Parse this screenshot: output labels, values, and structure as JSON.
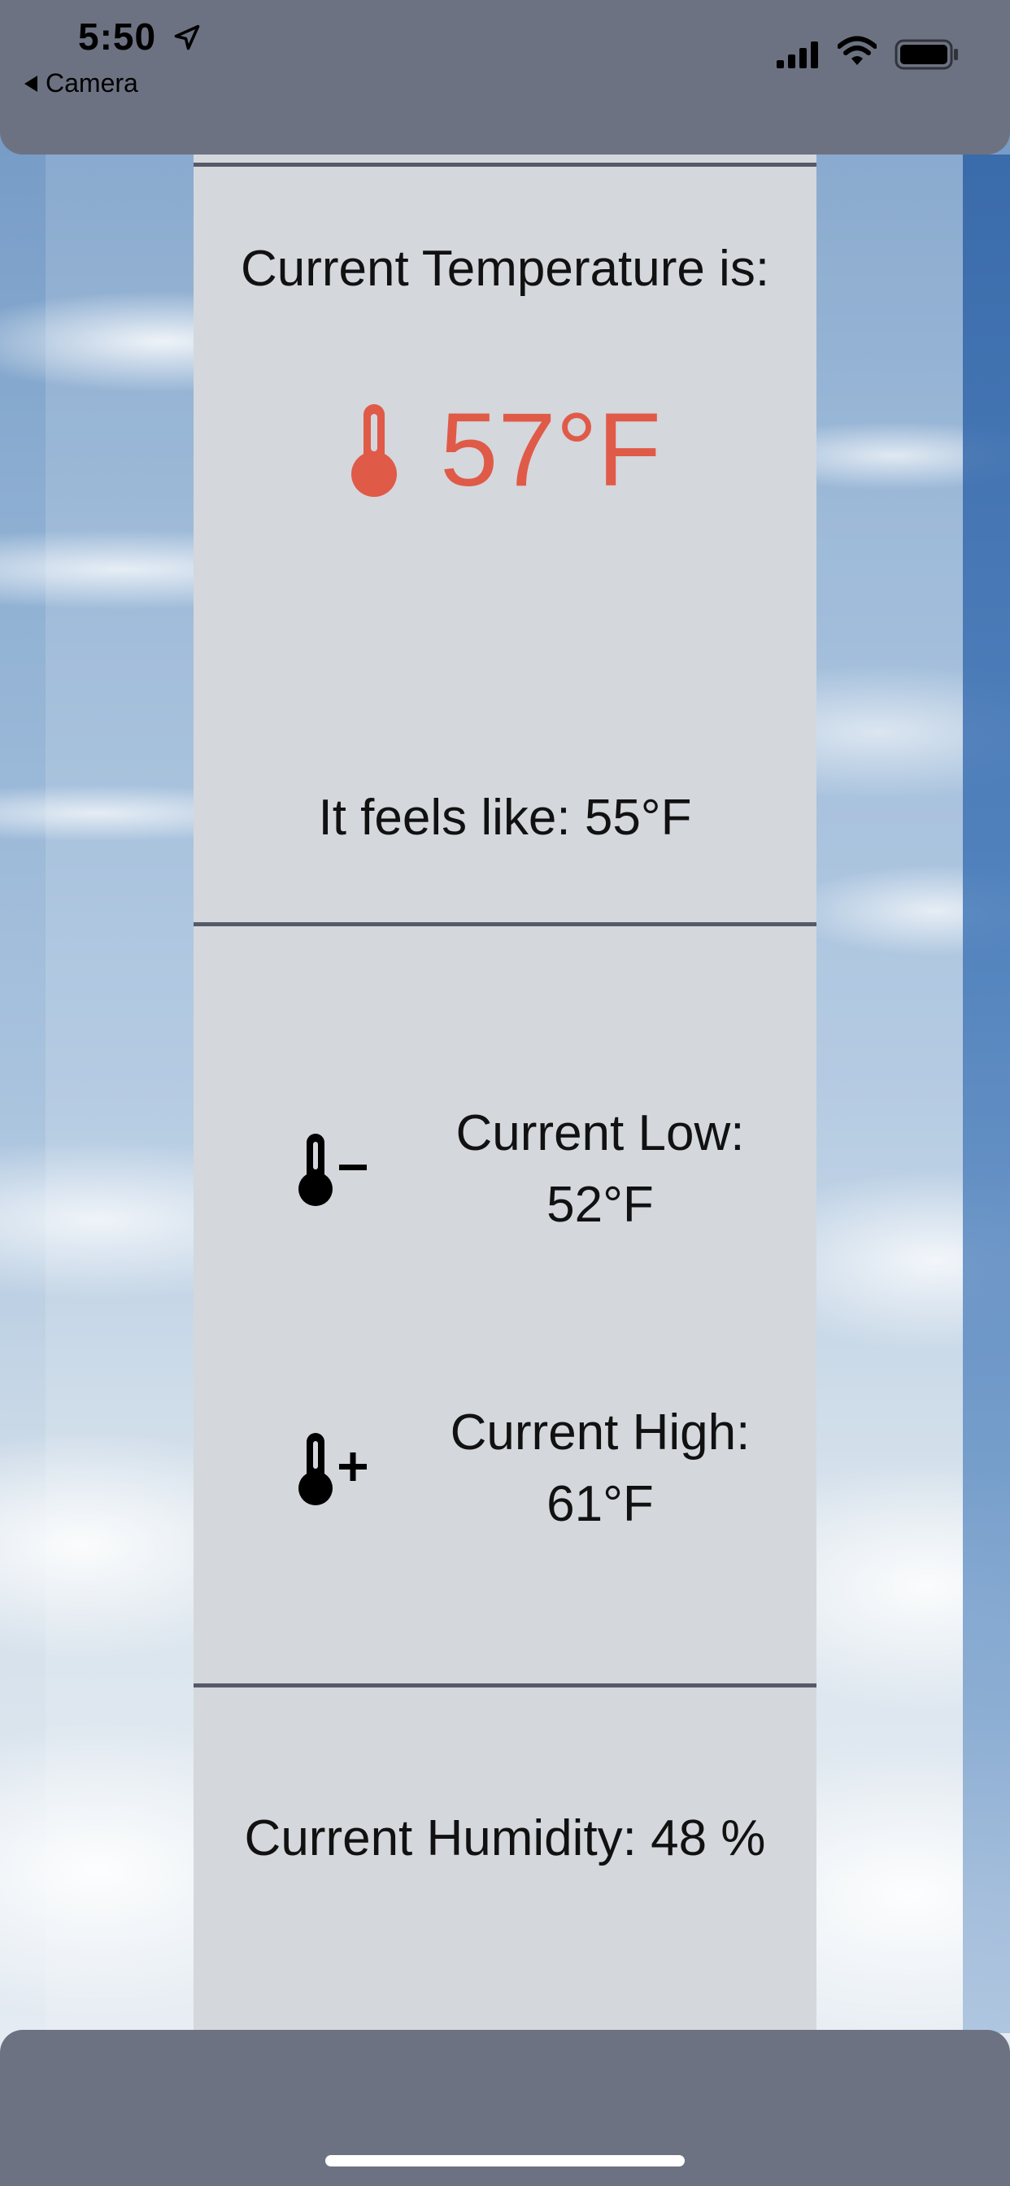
{
  "status_bar": {
    "time": "5:50",
    "back_label": "Camera",
    "icons": [
      "location-arrow-icon",
      "signal-icon",
      "wifi-icon",
      "battery-icon"
    ]
  },
  "current": {
    "label": "Current Temperature is:",
    "value": "57°F",
    "feels_like": "It feels like: 55°F",
    "accent_color": "#e05a48"
  },
  "low": {
    "label": "Current Low:",
    "value": "52°F",
    "icon": "thermometer-minus-icon"
  },
  "high": {
    "label": "Current High:",
    "value": "61°F",
    "icon": "thermometer-plus-icon"
  },
  "humidity": {
    "text": "Current Humidity: 48 %"
  },
  "colors": {
    "bar": "#6d7282",
    "card": "#d4d7dc",
    "divider": "#555a68"
  }
}
